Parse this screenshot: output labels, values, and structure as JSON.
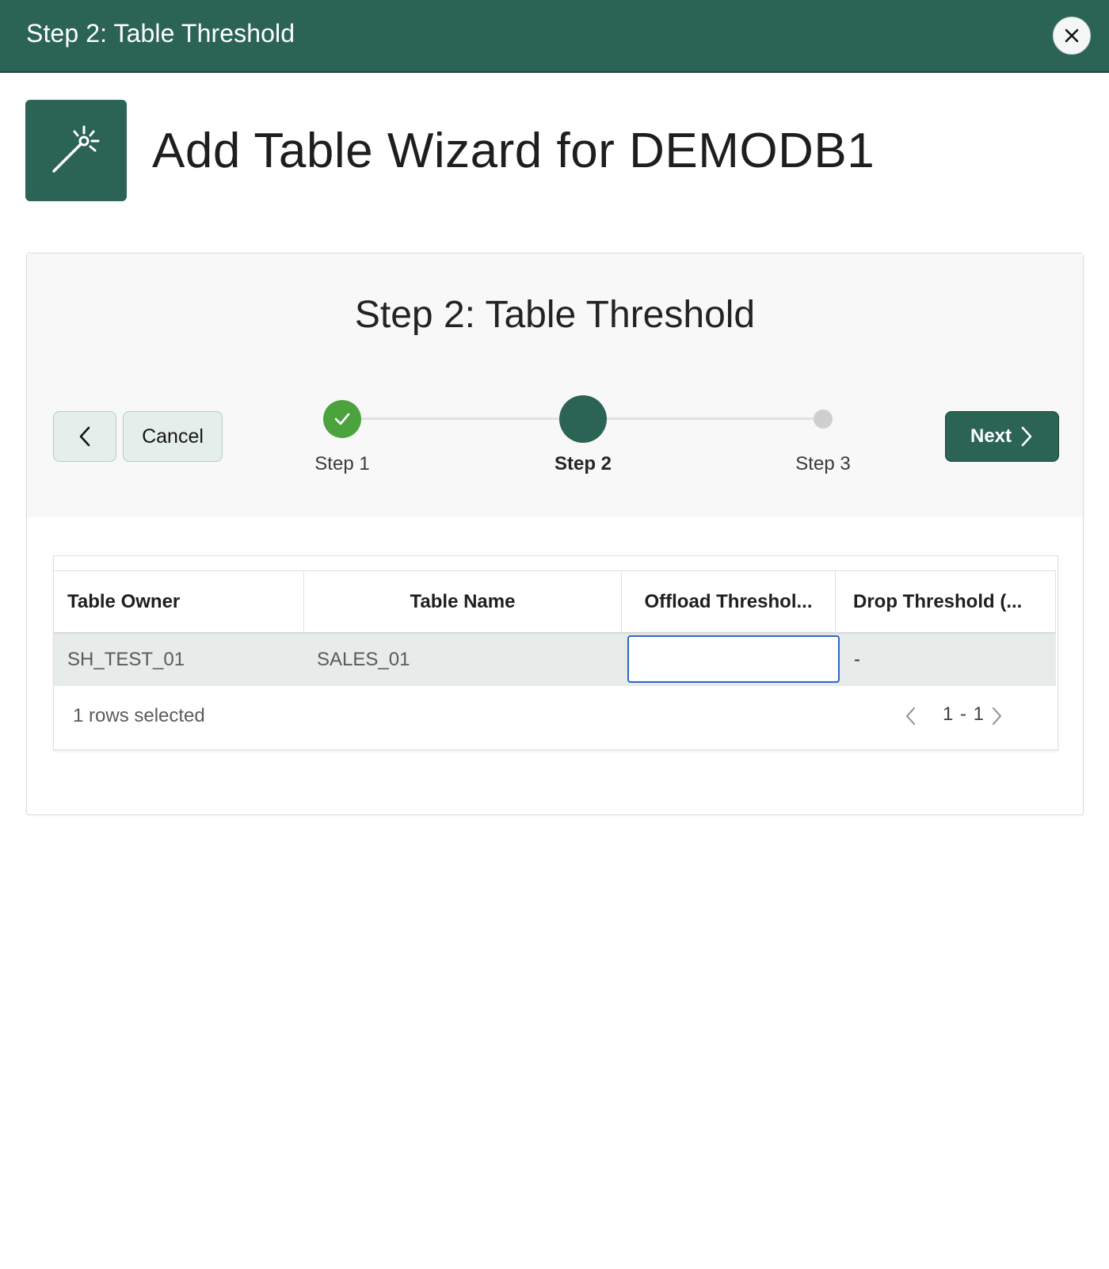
{
  "dialog": {
    "title": "Step 2: Table Threshold",
    "close_icon": "close-icon"
  },
  "header": {
    "icon": "magic-wand-icon",
    "title": "Add Table Wizard for DEMODB1"
  },
  "wizard": {
    "heading": "Step 2: Table Threshold",
    "back_icon": "chevron-left-icon",
    "cancel_label": "Cancel",
    "next_label": "Next",
    "next_icon": "chevron-right-icon",
    "steps": [
      {
        "label": "Step 1",
        "status": "completed"
      },
      {
        "label": "Step 2",
        "status": "current"
      },
      {
        "label": "Step 3",
        "status": "upcoming"
      }
    ]
  },
  "table": {
    "columns": [
      "Table Owner",
      "Table Name",
      "Offload Threshol...",
      "Drop Threshold (..."
    ],
    "rows": [
      {
        "owner": "SH_TEST_01",
        "name": "SALES_01",
        "offload": "",
        "drop": "-"
      }
    ],
    "selection_text": "1 rows selected",
    "pagination": "1 - 1"
  },
  "colors": {
    "brand": "#2b6455",
    "completed": "#4ca33e",
    "focus": "#2f66c8"
  }
}
